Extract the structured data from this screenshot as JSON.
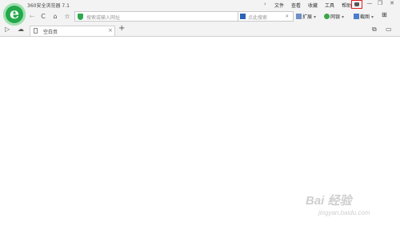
{
  "window": {
    "title": "360安全浏览器 7.1",
    "menu": [
      "文件",
      "查看",
      "收藏",
      "工具",
      "帮助"
    ],
    "controls": {
      "minimize": "—",
      "maximize": "❐",
      "close": "✕"
    }
  },
  "navbar": {
    "back": "←",
    "refresh": "C",
    "home": "⌂",
    "favorite": "☆",
    "address_placeholder": "搜索或输入网址",
    "search_placeholder": "点此搜索",
    "tools": [
      {
        "label": "扩展",
        "icon": "grid-icon"
      },
      {
        "label": "网银",
        "icon": "coin-icon"
      },
      {
        "label": "截图",
        "icon": "scissors-icon"
      }
    ]
  },
  "tabs": {
    "items": [
      {
        "label": "空白页",
        "active": true
      }
    ],
    "new_tab": "+"
  },
  "watermark": {
    "brand": "Bai 经验",
    "domain": "jingyan.baidu.com"
  },
  "colors": {
    "logo": "#23a84a",
    "highlight": "#e02020",
    "chrome": "#f3f3f3"
  }
}
